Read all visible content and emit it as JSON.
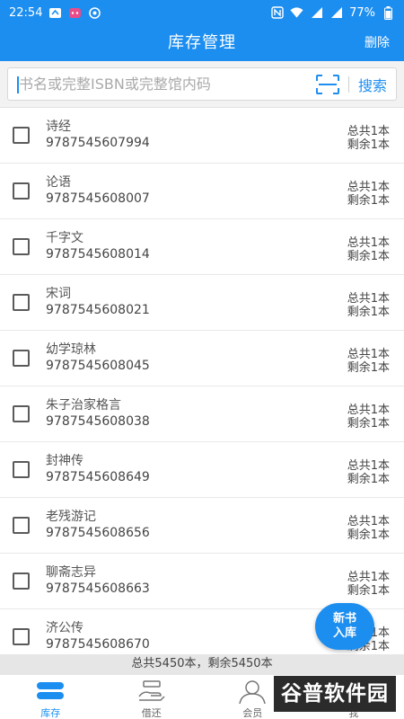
{
  "status_bar": {
    "time": "22:54",
    "battery": "77%"
  },
  "app_bar": {
    "title": "库存管理",
    "delete_label": "删除"
  },
  "search": {
    "placeholder": "书名或完整ISBN或完整馆内码",
    "button_label": "搜索"
  },
  "books": [
    {
      "title": "诗经",
      "isbn": "9787545607994",
      "total": "总共1本",
      "remain": "剩余1本"
    },
    {
      "title": "论语",
      "isbn": "9787545608007",
      "total": "总共1本",
      "remain": "剩余1本"
    },
    {
      "title": "千字文",
      "isbn": "9787545608014",
      "total": "总共1本",
      "remain": "剩余1本"
    },
    {
      "title": "宋词",
      "isbn": "9787545608021",
      "total": "总共1本",
      "remain": "剩余1本"
    },
    {
      "title": "幼学琼林",
      "isbn": "9787545608045",
      "total": "总共1本",
      "remain": "剩余1本"
    },
    {
      "title": "朱子治家格言",
      "isbn": "9787545608038",
      "total": "总共1本",
      "remain": "剩余1本"
    },
    {
      "title": "封神传",
      "isbn": "9787545608649",
      "total": "总共1本",
      "remain": "剩余1本"
    },
    {
      "title": "老残游记",
      "isbn": "9787545608656",
      "total": "总共1本",
      "remain": "剩余1本"
    },
    {
      "title": "聊斋志异",
      "isbn": "9787545608663",
      "total": "总共1本",
      "remain": "剩余1本"
    },
    {
      "title": "济公传",
      "isbn": "9787545608670",
      "total": "总共1本",
      "remain": "剩余1本"
    }
  ],
  "summary": "总共5450本，剩余5450本",
  "fab": {
    "line1": "新书",
    "line2": "入库"
  },
  "tabs": [
    {
      "label": "库存",
      "icon": "inventory-icon",
      "active": true
    },
    {
      "label": "借还",
      "icon": "borrow-return-icon",
      "active": false
    },
    {
      "label": "会员",
      "icon": "member-icon",
      "active": false
    },
    {
      "label": "我",
      "icon": "profile-icon",
      "active": false
    }
  ],
  "watermark": {
    "text": "谷普软件园"
  },
  "colors": {
    "primary": "#1c8ef0",
    "summary_bg": "#e6e6e6",
    "search_bg": "#f2f2f2"
  }
}
